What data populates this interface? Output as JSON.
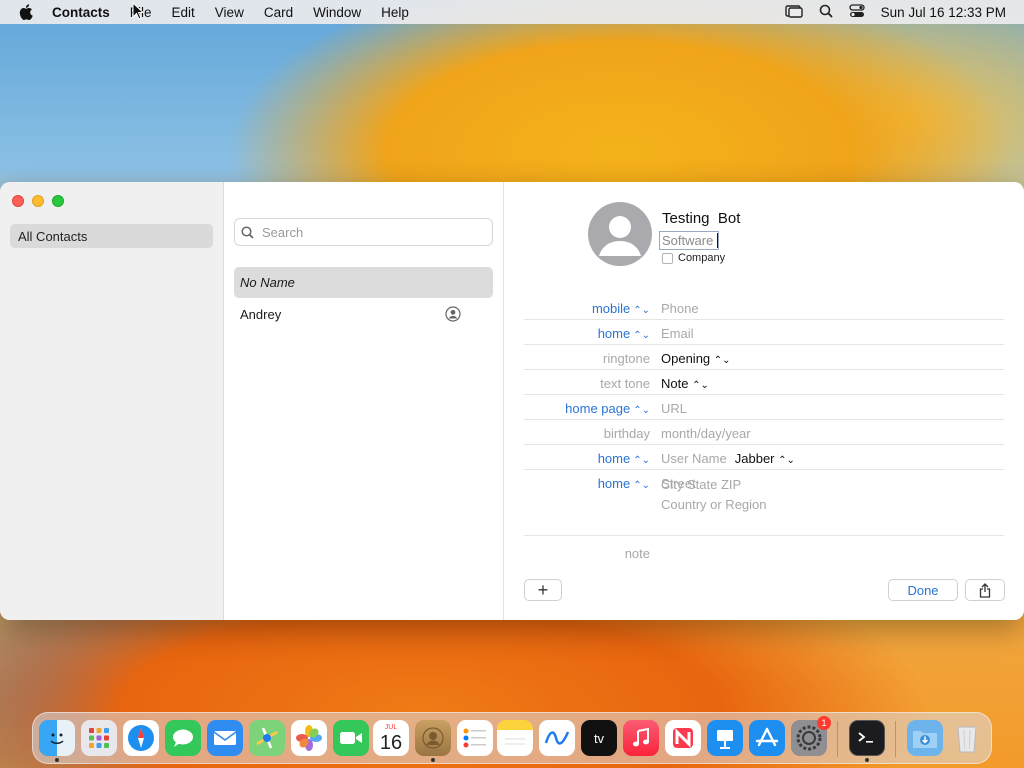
{
  "menubar": {
    "app_name": "Contacts",
    "items": [
      "File",
      "Edit",
      "View",
      "Card",
      "Window",
      "Help"
    ],
    "clock": "Sun Jul 16  12:33 PM"
  },
  "sidebar": {
    "group": "All Contacts"
  },
  "list": {
    "search_placeholder": "Search",
    "contacts": [
      "No Name",
      "Andrey"
    ]
  },
  "card": {
    "first_name": "Testing",
    "last_name": "Bot",
    "company_value": "Software",
    "company_checkbox_label": "Company",
    "fields": [
      {
        "label": "mobile",
        "value": "Phone"
      },
      {
        "label": "home",
        "value": "Email"
      },
      {
        "label": "ringtone",
        "value": "Opening"
      },
      {
        "label": "text tone",
        "value": "Note"
      },
      {
        "label": "home page",
        "value": "URL"
      },
      {
        "label": "birthday",
        "value": "month/day/year"
      },
      {
        "label": "home",
        "value": "User Name",
        "extra": "Jabber"
      },
      {
        "label": "home",
        "value": "Street"
      }
    ],
    "address_lines": [
      "City State ZIP",
      "Country or Region"
    ],
    "note_label": "note",
    "add_label": "+",
    "done_label": "Done"
  },
  "dock": {
    "calendar_month": "JUL",
    "calendar_day": "16",
    "tv_label": "tv",
    "settings_badge": "1"
  },
  "colors": {
    "accent_blue": "#2a74d4",
    "close": "#fe5f57",
    "minimize": "#febc2e",
    "maximize": "#28c840"
  }
}
